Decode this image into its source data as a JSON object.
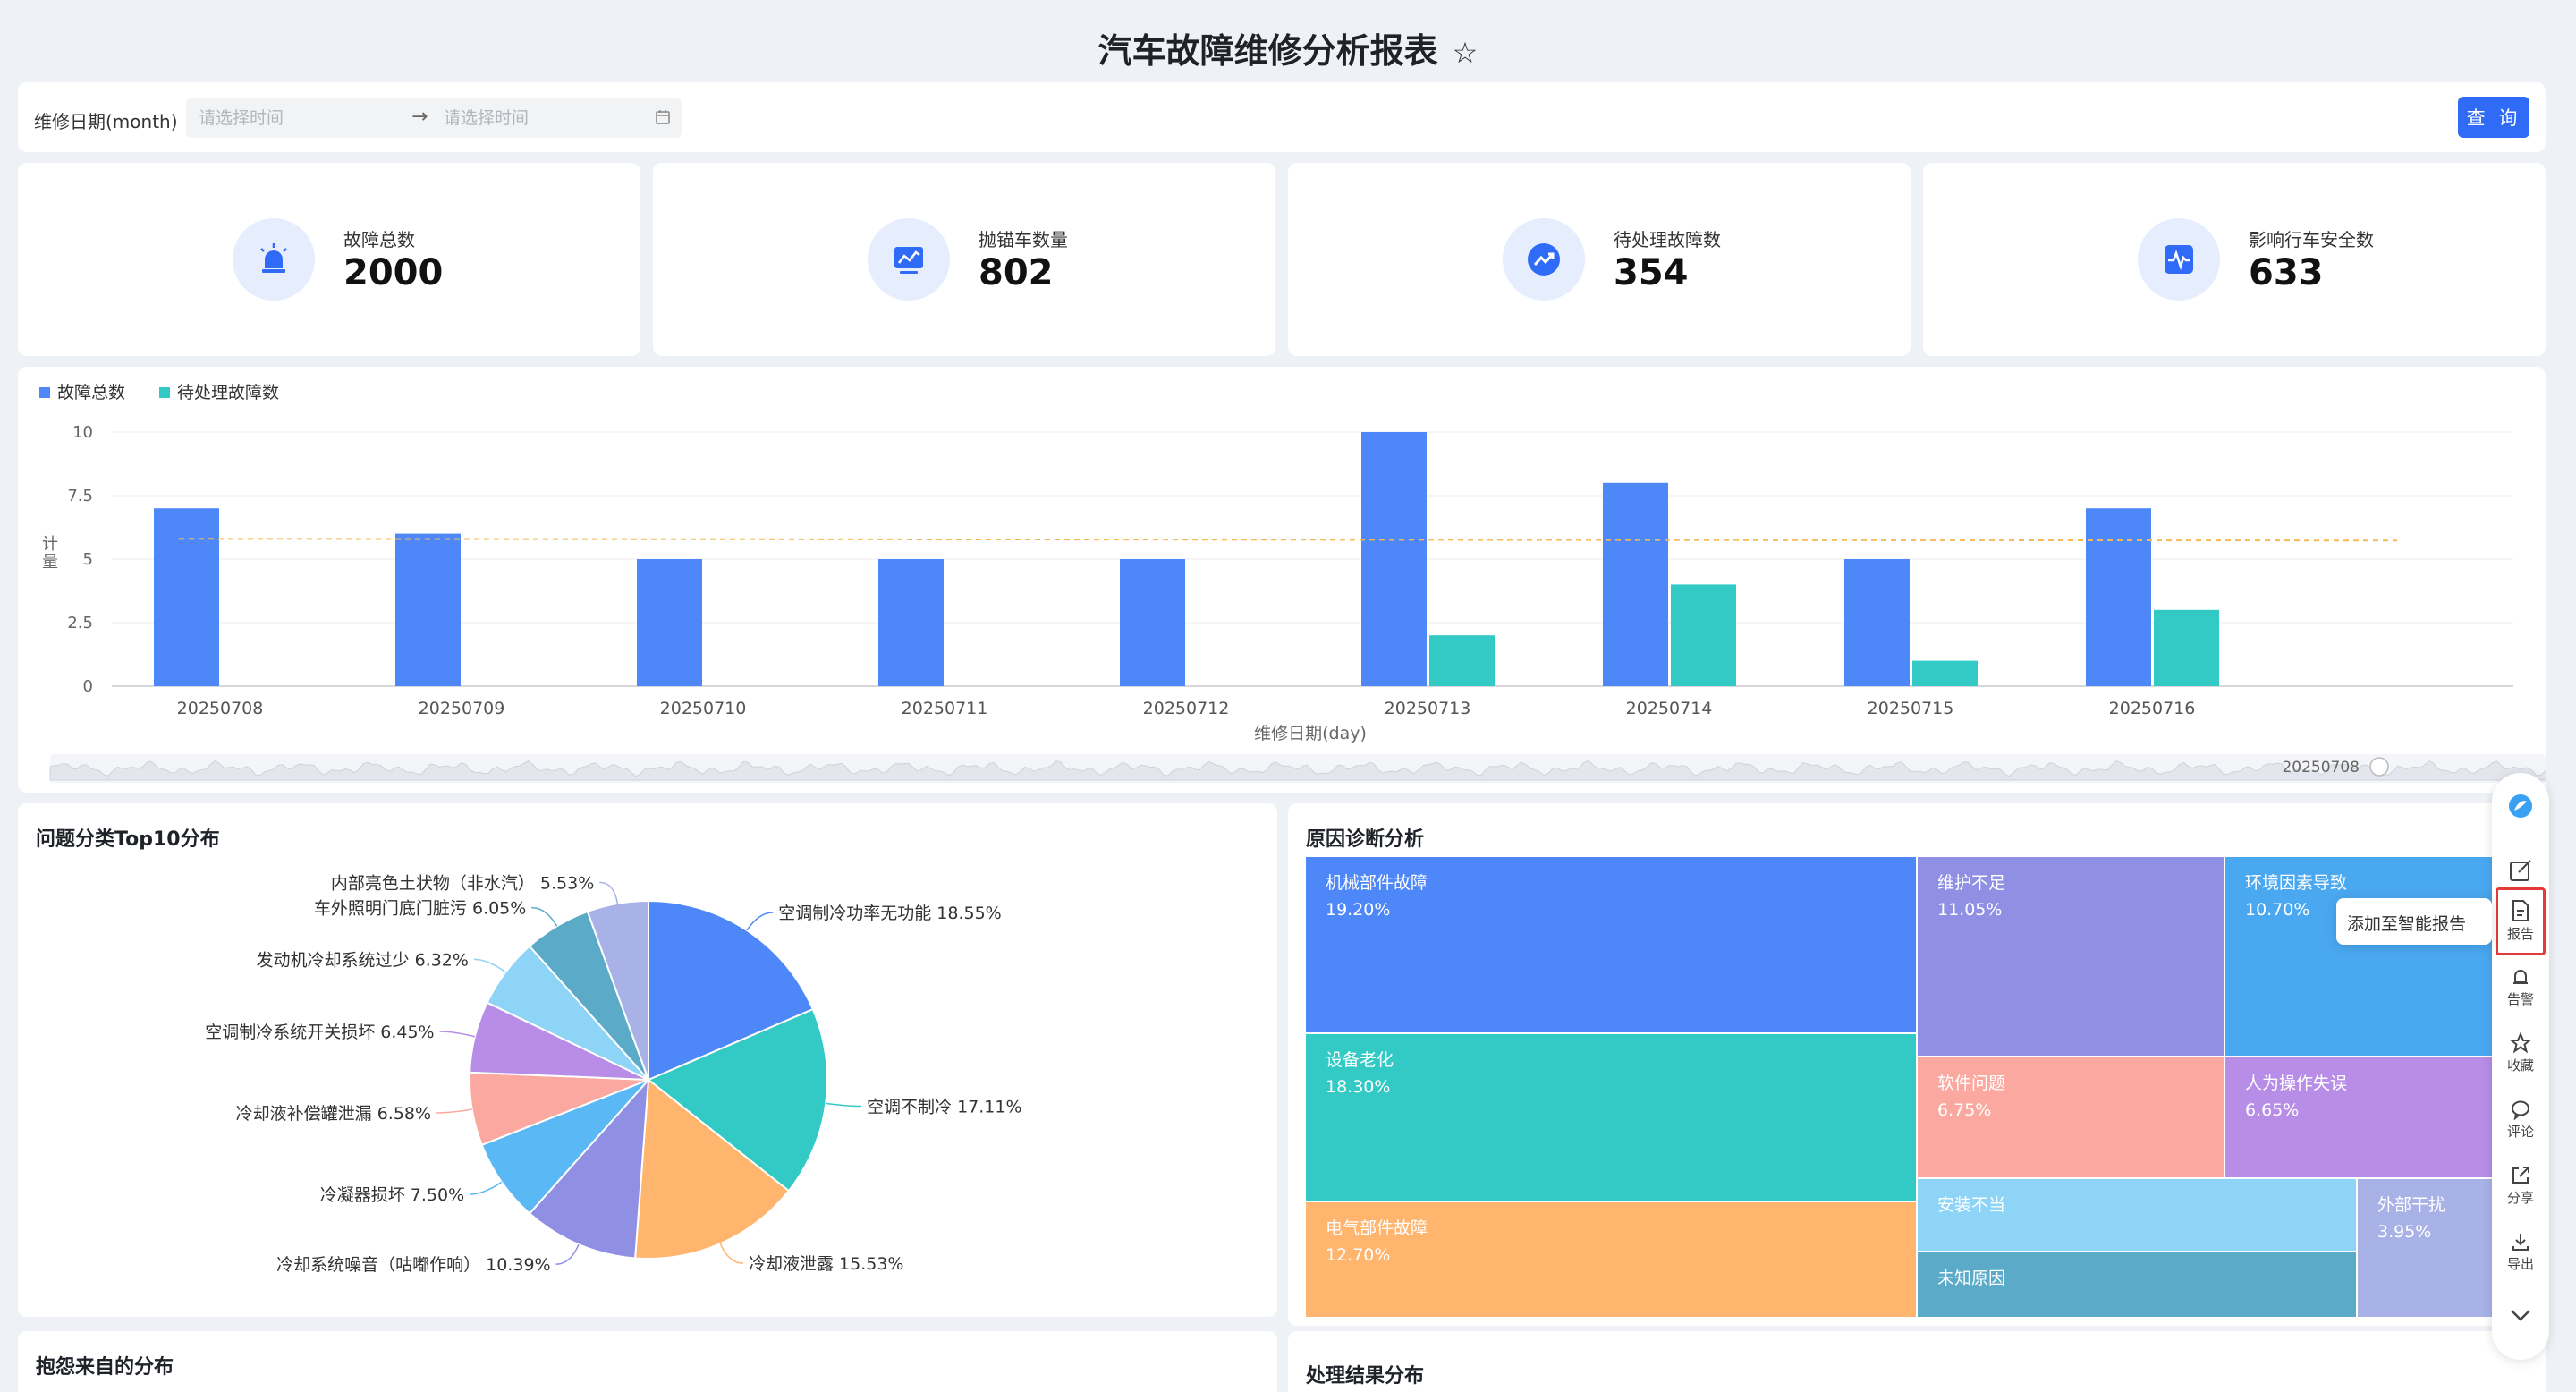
{
  "page": {
    "title": "汽车故障维修分析报表"
  },
  "filter": {
    "label": "维修日期(month)",
    "start_placeholder": "请选择时间",
    "end_placeholder": "请选择时间",
    "query_label": "查 询"
  },
  "kpis": [
    {
      "label": "故障总数",
      "value": "2000",
      "icon": "alarm-light-icon"
    },
    {
      "label": "抛锚车数量",
      "value": "802",
      "icon": "monitor-chart-icon"
    },
    {
      "label": "待处理故障数",
      "value": "354",
      "icon": "trend-up-icon"
    },
    {
      "label": "影响行车安全数",
      "value": "633",
      "icon": "heartbeat-icon"
    }
  ],
  "colors": {
    "primary": "#4e87f8",
    "teal": "#33cac6",
    "accent": "#2f6bf6",
    "avg_line": "#f5b957"
  },
  "chart_data": [
    {
      "type": "bar",
      "categories": [
        "20250708",
        "20250709",
        "20250710",
        "20250711",
        "20250712",
        "20250713",
        "20250714",
        "20250715",
        "20250716"
      ],
      "series": [
        {
          "name": "故障总数",
          "values": [
            7,
            6,
            5,
            5,
            5,
            10,
            8,
            5,
            7
          ]
        },
        {
          "name": "待处理故障数",
          "values": [
            null,
            null,
            null,
            null,
            null,
            2,
            4,
            1,
            3
          ]
        }
      ],
      "xlabel": "维修日期(day)",
      "ylabel": "计量",
      "ylim": [
        0,
        10
      ],
      "yticks": [
        "0",
        "2.5",
        "5",
        "7.5",
        "10"
      ],
      "average_line": 5.8,
      "legend": "top-left",
      "grid": true,
      "slider_label": "20250708"
    },
    {
      "type": "pie",
      "title": "问题分类Top10分布",
      "slices": [
        {
          "label": "空调制冷功率无功能",
          "pct": "18.55%",
          "value": 18.55,
          "color": "#4e87f8"
        },
        {
          "label": "空调不制冷",
          "pct": "17.11%",
          "value": 17.11,
          "color": "#33cac6"
        },
        {
          "label": "冷却液泄露",
          "pct": "15.53%",
          "value": 15.53,
          "color": "#ffb56e"
        },
        {
          "label": "冷却系统噪音（咕嘟作响）",
          "pct": "10.39%",
          "value": 10.39,
          "color": "#8f8fe3"
        },
        {
          "label": "冷凝器损坏",
          "pct": "7.50%",
          "value": 7.5,
          "color": "#5ab8f4"
        },
        {
          "label": "冷却液补偿罐泄漏",
          "pct": "6.58%",
          "value": 6.58,
          "color": "#fba8a0"
        },
        {
          "label": "空调制冷系统开关损坏",
          "pct": "6.45%",
          "value": 6.45,
          "color": "#b78de8"
        },
        {
          "label": "发动机冷却系统过少",
          "pct": "6.32%",
          "value": 6.32,
          "color": "#8ed4f6"
        },
        {
          "label": "车外照明门底门脏污",
          "pct": "6.05%",
          "value": 6.05,
          "color": "#5aaac8"
        },
        {
          "label": "内部亮色土状物（非水汽）",
          "pct": "5.53%",
          "value": 5.53,
          "color": "#a8b2e6"
        }
      ]
    },
    {
      "type": "treemap",
      "title": "原因诊断分析",
      "items": [
        {
          "label": "机械部件故障",
          "pct": "19.20%",
          "color": "#4e87f8"
        },
        {
          "label": "维护不足",
          "pct": "11.05%",
          "color": "#8f8fe3"
        },
        {
          "label": "环境因素导致",
          "pct": "10.70%",
          "color": "#4aa8f0"
        },
        {
          "label": "设备老化",
          "pct": "18.30%",
          "color": "#33cac6"
        },
        {
          "label": "软件问题",
          "pct": "6.75%",
          "color": "#fba8a0"
        },
        {
          "label": "人为操作失误",
          "pct": "6.65%",
          "color": "#b78de8"
        },
        {
          "label": "电气部件故障",
          "pct": "12.70%",
          "color": "#ffb56e"
        },
        {
          "label": "安装不当",
          "pct": "",
          "color": "#8ed4f6"
        },
        {
          "label": "外部干扰",
          "pct": "3.95%",
          "color": "#a8b2e6"
        },
        {
          "label": "未知原因",
          "pct": "",
          "color": "#5aaac8"
        }
      ]
    }
  ],
  "sections": {
    "complaint_source": "抱怨来自的分布",
    "result_dist": "处理结果分布"
  },
  "sidebar": {
    "items": [
      {
        "label": "",
        "icon": "ai-logo-icon"
      },
      {
        "label": "",
        "icon": "edit-icon"
      },
      {
        "label": "报告",
        "icon": "report-icon"
      },
      {
        "label": "告警",
        "icon": "bell-icon"
      },
      {
        "label": "收藏",
        "icon": "star-icon"
      },
      {
        "label": "评论",
        "icon": "comment-icon"
      },
      {
        "label": "分享",
        "icon": "share-icon"
      },
      {
        "label": "导出",
        "icon": "download-icon"
      },
      {
        "label": "",
        "icon": "chevron-down-icon"
      }
    ],
    "tooltip": "添加至智能报告"
  }
}
